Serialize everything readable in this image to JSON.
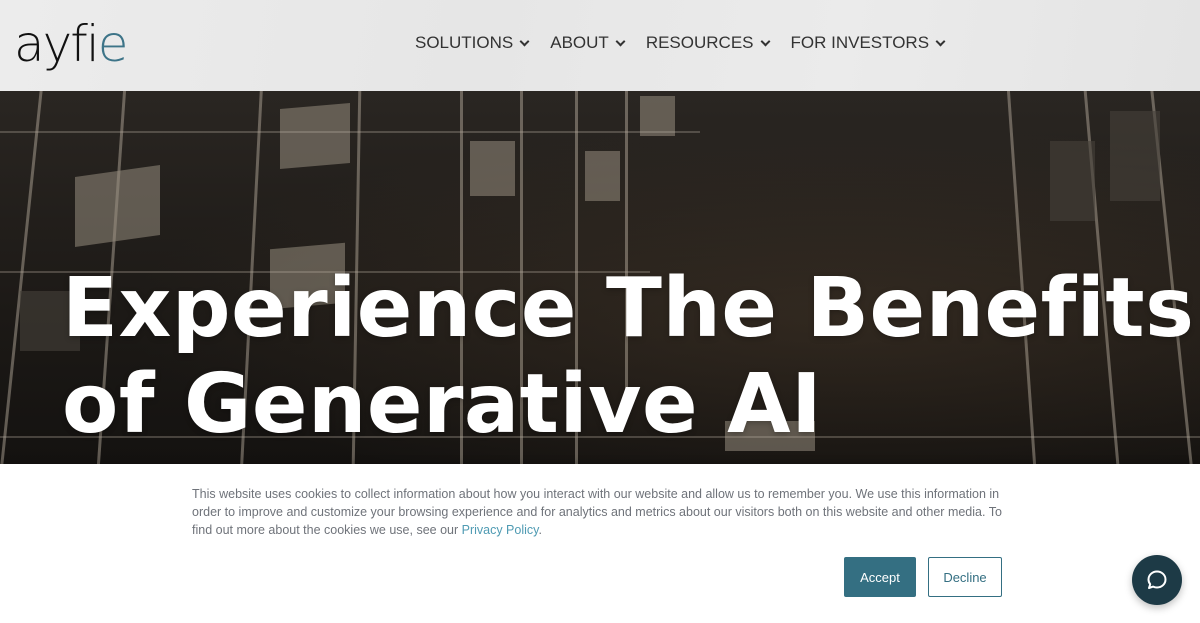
{
  "header": {
    "logo": {
      "text_main": "ayfi",
      "text_accent": "e"
    },
    "nav": [
      {
        "label": "SOLUTIONS"
      },
      {
        "label": "ABOUT"
      },
      {
        "label": "RESOURCES"
      },
      {
        "label": "FOR INVESTORS"
      }
    ]
  },
  "hero": {
    "title_line1": "Experience The Benefits",
    "title_line2": "of Generative AI"
  },
  "cookie_banner": {
    "text": "This website uses cookies to collect information about how you interact with our website and allow us to remember you. We use this information in order to improve and customize your browsing experience and for analytics and metrics about our visitors both on this website and other media. To find out more about the cookies we use, see our ",
    "link_label": "Privacy Policy",
    "text_end": ".",
    "accept_label": "Accept",
    "decline_label": "Decline"
  },
  "chat_widget": {
    "icon": "chat-bubble-icon"
  },
  "colors": {
    "brand_accent": "#3d7488",
    "button_primary": "#346f82",
    "chat_bg": "#1d3a46",
    "link": "#4f9bb3"
  }
}
